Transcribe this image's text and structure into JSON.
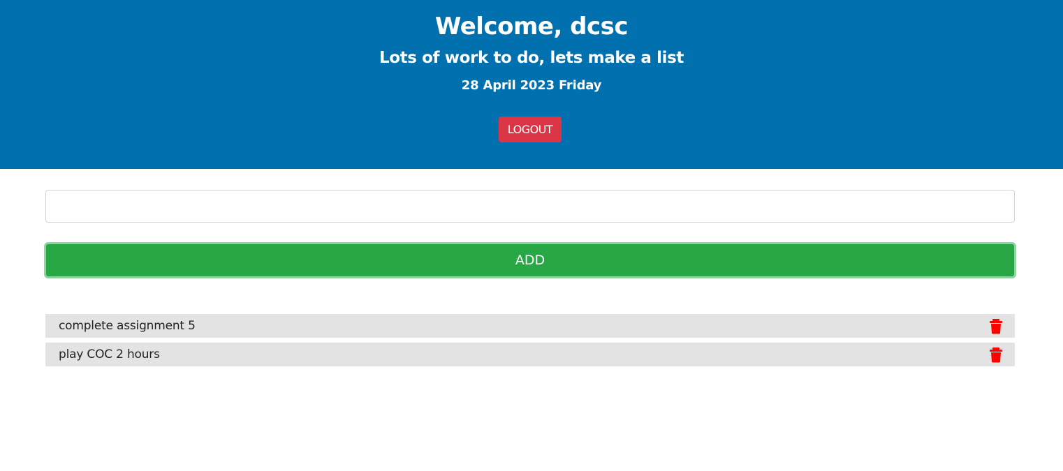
{
  "header": {
    "title": "Welcome, dcsc",
    "subtitle": "Lots of work to do, lets make a list",
    "date": "28 April 2023 Friday",
    "logout_label": "LOGOUT"
  },
  "form": {
    "input_value": "",
    "input_placeholder": "",
    "add_label": "ADD"
  },
  "tasks": [
    {
      "text": "complete assignment 5",
      "icon": "trash-icon"
    },
    {
      "text": "play COC 2 hours",
      "icon": "trash-icon"
    }
  ],
  "colors": {
    "header_bg": "#0070af",
    "logout_bg": "#dc3545",
    "add_bg": "#28a745",
    "task_bg": "#e3e3e3",
    "delete_icon": "#ff0000"
  }
}
